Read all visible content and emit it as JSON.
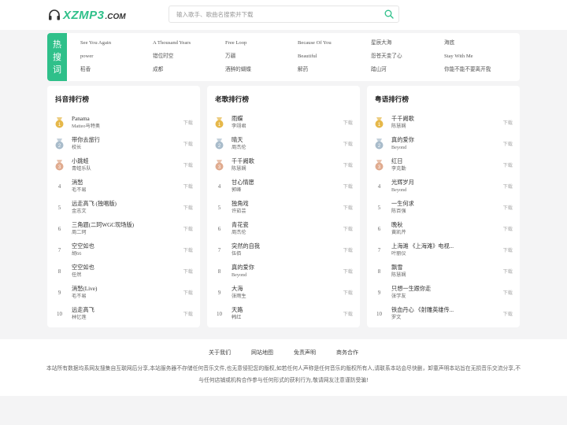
{
  "header": {
    "logo_main": "XZMP3",
    "logo_suffix": ".COM",
    "search_placeholder": "输入歌手、歌曲名搜索并下载"
  },
  "hot": {
    "label": [
      "热",
      "搜",
      "词"
    ],
    "items": [
      "See You Again",
      "A Thousand Years",
      "Free Loop",
      "Because Of You",
      "星辰大海",
      "海底",
      "power",
      "错位时空",
      "万疆",
      "Beautiful",
      "怨苍天变了心",
      "Stay With Me",
      "稻香",
      "成都",
      "酒醉的蝴蝶",
      "解药",
      "踏山河",
      "你能不能不要离开我"
    ]
  },
  "download_label": "下载",
  "charts": [
    {
      "title": "抖音排行榜",
      "rows": [
        {
          "rank": "1",
          "song": "Panama",
          "artist": "Matteo马特奥"
        },
        {
          "rank": "2",
          "song": "带你去旅行",
          "artist": "校长"
        },
        {
          "rank": "3",
          "song": "小跳蛙",
          "artist": "青蛙乐队"
        },
        {
          "rank": "4",
          "song": "消愁",
          "artist": "毛不易"
        },
        {
          "rank": "5",
          "song": "远走高飞 (独唱版)",
          "artist": "金志文"
        },
        {
          "rank": "6",
          "song": "三角题(二珂WGC现场版)",
          "artist": "周二珂"
        },
        {
          "rank": "7",
          "song": "空空如也",
          "artist": "胡66"
        },
        {
          "rank": "8",
          "song": "空空如也",
          "artist": "任然"
        },
        {
          "rank": "9",
          "song": "消愁(Live)",
          "artist": "毛不易"
        },
        {
          "rank": "10",
          "song": "远走高飞",
          "artist": "林忆莲"
        }
      ]
    },
    {
      "title": "老歌排行榜",
      "rows": [
        {
          "rank": "1",
          "song": "雨蝶",
          "artist": "李翊君"
        },
        {
          "rank": "2",
          "song": "晴天",
          "artist": "周杰伦"
        },
        {
          "rank": "3",
          "song": "千千阙歌",
          "artist": "陈慧娴"
        },
        {
          "rank": "4",
          "song": "甘心情愿",
          "artist": "郭峰"
        },
        {
          "rank": "5",
          "song": "独角戏",
          "artist": "许茹芸"
        },
        {
          "rank": "6",
          "song": "青花瓷",
          "artist": "周杰伦"
        },
        {
          "rank": "7",
          "song": "突然的自我",
          "artist": "伍佰"
        },
        {
          "rank": "8",
          "song": "真的爱你",
          "artist": "Beyond"
        },
        {
          "rank": "9",
          "song": "大海",
          "artist": "张雨生"
        },
        {
          "rank": "10",
          "song": "天路",
          "artist": "韩红"
        }
      ]
    },
    {
      "title": "粤语排行榜",
      "rows": [
        {
          "rank": "1",
          "song": "千千阙歌",
          "artist": "陈慧娴"
        },
        {
          "rank": "2",
          "song": "真的爱你",
          "artist": "Beyond"
        },
        {
          "rank": "3",
          "song": "红日",
          "artist": "李克勤"
        },
        {
          "rank": "4",
          "song": "光辉岁月",
          "artist": "Beyond"
        },
        {
          "rank": "5",
          "song": "一生何求",
          "artist": "陈百强"
        },
        {
          "rank": "6",
          "song": "晚秋",
          "artist": "黄凯芹"
        },
        {
          "rank": "7",
          "song": "上海滩 《上海滩》电视...",
          "artist": "叶丽仪"
        },
        {
          "rank": "8",
          "song": "飘雪",
          "artist": "陈慧娴"
        },
        {
          "rank": "9",
          "song": "只想一生跟你走",
          "artist": "张学友"
        },
        {
          "rank": "10",
          "song": "铁血丹心 《射雕英雄传...",
          "artist": "罗文"
        }
      ]
    }
  ],
  "footer": {
    "links": [
      "关于我们",
      "网站地图",
      "免责声明",
      "商务合作"
    ],
    "disclaimer": "本站所有数据均系网友搜集自互联网后分享,本站服务器不存储任何音乐文件,也无意侵犯您的版权,如若任何人声称是任何音乐的版权所有人,请联系本站会尽快删，卸童声明本站旨在无损音乐交流分享,不与任何店铺或机构合作参与任何形式的获利行为,敬请网友注意谨防受骗!"
  },
  "colors": {
    "accent": "#2fc08a",
    "gold": "#e6b84a",
    "silver": "#a9bccb",
    "bronze": "#e0ab8f"
  }
}
